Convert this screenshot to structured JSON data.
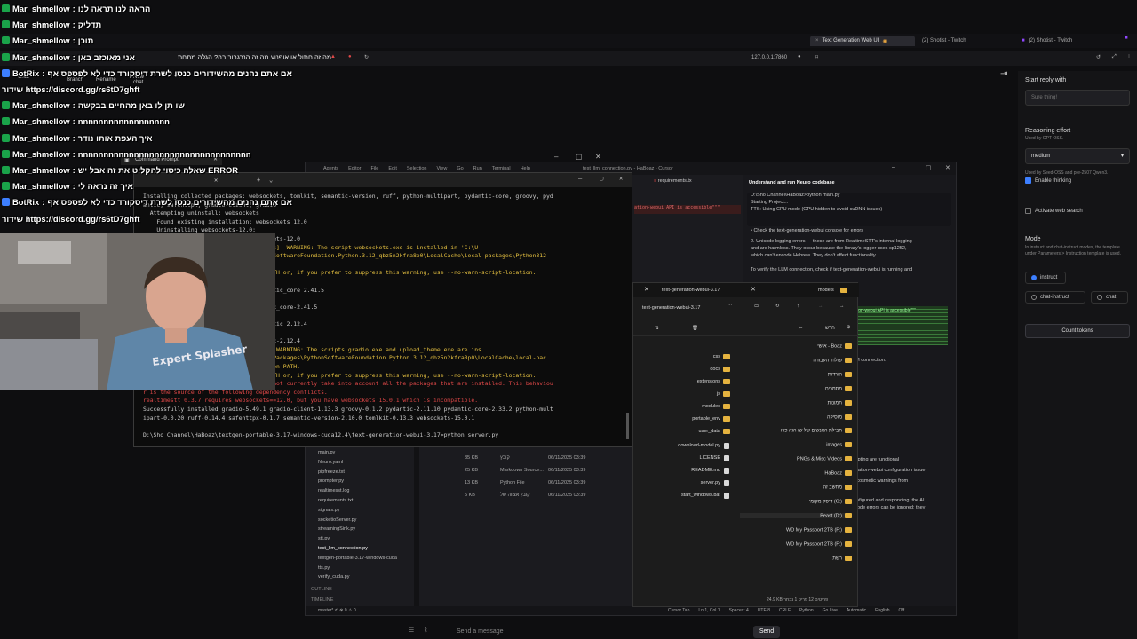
{
  "browser": {
    "tabs": [
      {
        "label": "Text Generation Web UI",
        "active": true
      },
      {
        "label": "(2) Shotist - Twitch"
      },
      {
        "label": "(2) Shotist - Twitch"
      }
    ],
    "url": "127.0.0.1:7860"
  },
  "webui": {
    "page_title": "מה זה חתול או אופנוע מה זה הנרגבור בה? הגלה מתחת...",
    "sidebar": {
      "new_chat": "New chat",
      "branch": "Branch",
      "rename": "Rename",
      "chat": "Chat"
    },
    "settings": {
      "start_reply_label": "Start reply with",
      "start_reply_placeholder": "Sure thing!",
      "reasoning_label": "Reasoning effort",
      "reasoning_sub": "Used by GPT-OSS.",
      "reasoning_value": "medium",
      "thinking_sub": "Used by Seed-OSS and pre-2507 Qwen3.",
      "enable_thinking": "Enable thinking",
      "web_search": "Activate web search",
      "mode_label": "Mode",
      "mode_sub": "In instruct and chat-instruct modes, the template under Parameters > Instruction template is used.",
      "modes": [
        "instruct",
        "chat-instruct",
        "chat"
      ],
      "count_tokens": "Count tokens"
    },
    "composer": {
      "placeholder": "Send a message",
      "send": "Send"
    }
  },
  "chat_overlay": [
    {
      "user": "Mar_shmellow",
      "msg": "הראה לנו תראה לנו",
      "badge": "#1aa34a"
    },
    {
      "user": "Mar_shmellow",
      "msg": "תדליק",
      "badge": "#1aa34a"
    },
    {
      "user": "Mar_shmellow",
      "msg": "תוכן",
      "badge": "#1aa34a"
    },
    {
      "user": "Mar_shmellow",
      "msg": "אני מאוכזב באן",
      "badge": "#1aa34a"
    },
    {
      "user": "BotRix",
      "msg": "אם אתם נהנים מהשידורים כנסו לשרת דיסקורד כדי לא לפספס אף",
      "badge": "#3d7fff"
    },
    {
      "user": "",
      "msg": "שידור https://discord.gg/rs6tD7ghft",
      "badge": ""
    },
    {
      "user": "Mar_shmellow",
      "msg": "שו תן לו באן מהחיים בבקשה",
      "badge": "#1aa34a"
    },
    {
      "user": "Mar_shmellow",
      "msg": "nnnnnnnnnnnnnnnnnn",
      "badge": "#1aa34a"
    },
    {
      "user": "Mar_shmellow",
      "msg": "איך העפת אותו נודר",
      "badge": "#1aa34a"
    },
    {
      "user": "Mar_shmellow",
      "msg": "nnnnnnnnnnnnnnnnnnnnnnnnnnnnnnnnnn",
      "badge": "#1aa34a"
    },
    {
      "user": "Mar_shmellow",
      "msg": "שאלה כיסוי להקליט את זה אבל יש ERROR",
      "badge": "#1aa34a"
    },
    {
      "user": "Mar_shmellow",
      "msg": "איך זה נראה לי",
      "badge": "#1aa34a"
    },
    {
      "user": "BotRix",
      "msg": "אם אתם נהנים מהשידורים כנסו לשרת דיסקורד כדי לא לפספס אף",
      "badge": "#3d7fff"
    },
    {
      "user": "",
      "msg": "שידור https://discord.gg/rs6tD7ghft",
      "badge": ""
    }
  ],
  "cursor": {
    "menu": [
      "Agents",
      "Editor",
      "File",
      "Edit",
      "Selection",
      "View",
      "Go",
      "Run",
      "Terminal",
      "Help"
    ],
    "title": "test_llm_connection.py - HaBoaz - Cursor",
    "tab_file": "requirements.tx",
    "ai_title": "Understand and run Neuro codebase",
    "ai_lines": [
      "D:\\Sho Channel\\HaBoaz>python main.py",
      "Starting Project...",
      "TTS: Using CPU mode (GPU hidden to avoid cuDNN issues)",
      "• Check the text-generation-webui console for errors",
      "2. Unicode logging errors — these are from RealtimeSTT's internal logging",
      "and are harmless. They occur because the library's logger uses cp1252,",
      "which can't encode Hebrew. They don't affect functionality.",
      "To verify the LLM connection, check if text-generation-webui is running and",
      "LLM connection:",
      "mpting are functional",
      "eration-webui configuration issue",
      "- cosmetic warnings from",
      "onfigured and responding, the AI",
      "icode errors can be ignored; they"
    ],
    "ai_code": "ation-webui API is accessible\"\"\"",
    "explorer": [
      "main.py",
      "Neuro.yaml",
      "pipfreeze.txt",
      "prompter.py",
      "realtimesst.log",
      "requirements.txt",
      "signals.py",
      "socketioServer.py",
      "streamingSink.py",
      "stt.py",
      "test_llm_connection.py",
      "textgen-portable-3.17-windows-cuda",
      "tts.py",
      "verify_cuda.py"
    ],
    "outline": "OUTLINE",
    "timeline": "TIMELINE",
    "status_left": "master* ⟲ ⊗ 0 ⚠ 0",
    "status_right": [
      "Cursor Tab",
      "Ln 1, Col 1",
      "Spaces: 4",
      "UTF-8",
      "CRLF",
      "Python",
      "Go Live",
      "Automatic",
      "English",
      "Off"
    ]
  },
  "file_explorer": {
    "tab": "text-generation-webui-3.17",
    "tab2": "models",
    "path": "text-generation-webui-3.17",
    "new_label": "חדש",
    "folders": [
      "css",
      "docs",
      "extensions",
      "js",
      "modules",
      "portable_env",
      "user_data"
    ],
    "files": [
      {
        "name": "download-model.py",
        "date": "",
        "type": "",
        "size": ""
      },
      {
        "name": "LICENSE",
        "date": "06/11/2025 03:39",
        "type": "קובץ",
        "size": "35 KB"
      },
      {
        "name": "README.md",
        "date": "06/11/2025 03:39",
        "type": "Markdown Source...",
        "size": "25 KB"
      },
      {
        "name": "server.py",
        "date": "06/11/2025 03:39",
        "type": "Python File",
        "size": "13 KB"
      },
      {
        "name": "start_windows.bat",
        "date": "06/11/2025 03:39",
        "type": "קובץ אצווה של",
        "size": "5 KB"
      }
    ],
    "nav": [
      "אישי - Boaz",
      "שולחן העבודה",
      "הורדות",
      "מסמכים",
      "תמונות",
      "מוסיקה",
      "חבילת האנשים של שו הוא פרו",
      "images",
      "PNGs & Misc Videos",
      "HaBoaz",
      "מחשב זה",
      "דיסק מקומי (C:)",
      "Beast (D:)",
      "WD My Passport 2TB (F:)",
      "WD My Passport 2TB (F:)",
      "רשת"
    ],
    "status": "24.9 KB  פריטים 12  פריט 1 נבחר"
  },
  "cmd": {
    "tab": "Command Prompt",
    "lines": [
      {
        "t": "Installing collected packages: websockets, tomlkit, semantic-version, ruff, python-multipart, pydantic-core, groovy, pyd",
        "c": ""
      },
      {
        "t": "antic, safehttpx, gradio-client, gradio",
        "c": ""
      },
      {
        "t": "  Attempting uninstall: websockets",
        "c": ""
      },
      {
        "t": "    Found existing installation: websockets 12.0",
        "c": ""
      },
      {
        "t": "    Uninstalling websockets-12.0:",
        "c": ""
      },
      {
        "t": "      Successfully uninstalled websockets-12.0",
        "c": ""
      },
      {
        "t": "   ━━━━━━━━━━━━━━━━━━━ 0/11 [websockets]  WARNING: The script websockets.exe is installed in 'C:\\U",
        "c": "warn"
      },
      {
        "t": "sers\\...\\AppData\\Local\\Packages\\PythonSoftwareFoundation.Python.3.12_qbz5n2kfra8p0\\LocalCache\\local-packages\\Python312",
        "c": "warn"
      },
      {
        "t": "  \\Scripts' which is not on PATH.",
        "c": "warn"
      },
      {
        "t": "  Consider adding this directory to PATH or, if you prefer to suppress this warning, use --no-warn-script-location.",
        "c": "warn"
      },
      {
        "t": "  Attempting uninstall: pydantic-core",
        "c": ""
      },
      {
        "t": "    Found existing installation: pydantic_core 2.41.5",
        "c": ""
      },
      {
        "t": "    Uninstalling pydantic_core-2.41.5:",
        "c": ""
      },
      {
        "t": "      Successfully uninstalled pydantic_core-2.41.5",
        "c": ""
      },
      {
        "t": "  Attempting uninstall: pydantic",
        "c": ""
      },
      {
        "t": "    Found existing installation: pydantic 2.12.4",
        "c": ""
      },
      {
        "t": "    Uninstalling pydantic-2.12.4:",
        "c": ""
      },
      {
        "t": "      Successfully uninstalled pydantic-2.12.4",
        "c": ""
      },
      {
        "t": "   ━━━━━━━━━━━━━━━━━━━ 10/11 [gradio]  WARNING: The scripts gradio.exe and upload_theme.exe are ins",
        "c": "warn"
      },
      {
        "t": "talled in 'C:\\Users\\...\\AppData\\Local\\Packages\\PythonSoftwareFoundation.Python.3.12_qbz5n2kfra8p0\\LocalCache\\local-pac",
        "c": "warn"
      },
      {
        "t": "kages\\Python312\\Scripts' which is not on PATH.",
        "c": "warn"
      },
      {
        "t": "  Consider adding this directory to PATH or, if you prefer to suppress this warning, use --no-warn-script-location.",
        "c": "warn"
      },
      {
        "t": "ERROR: pip's dependency resolver does not currently take into account all the packages that are installed. This behaviou",
        "c": "err"
      },
      {
        "t": "r is the source of the following dependency conflicts.",
        "c": "err"
      },
      {
        "t": "realtimestt 0.3.7 requires websockets==12.0, but you have websockets 15.0.1 which is incompatible.",
        "c": "err"
      },
      {
        "t": "Successfully installed gradio-5.49.1 gradio-client-1.13.3 groovy-0.1.2 pydantic-2.11.10 pydantic-core-2.33.2 python-mult",
        "c": ""
      },
      {
        "t": "ipart-0.0.20 ruff-0.14.4 safehttpx-0.1.7 semantic-version-2.10.0 tomlkit-0.13.3 websockets-15.0.1",
        "c": ""
      },
      {
        "t": "",
        "c": ""
      },
      {
        "t": "D:\\Sho Channel\\HaBoaz\\textgen-portable-3.17-windows-cuda12.4\\text-generation-webui-3.17>python server.py",
        "c": ""
      }
    ]
  },
  "webcam": {
    "shirt_text": "Expert Splasher",
    "colors": {
      "wall": "#7d7a77",
      "shirt": "#5f86a8",
      "skin": "#d9a58f",
      "hair": "#3a2c22"
    }
  },
  "colors": {
    "accent": "#3d7fff",
    "folder": "#e5b33f",
    "twitch": "#1aa34a"
  }
}
